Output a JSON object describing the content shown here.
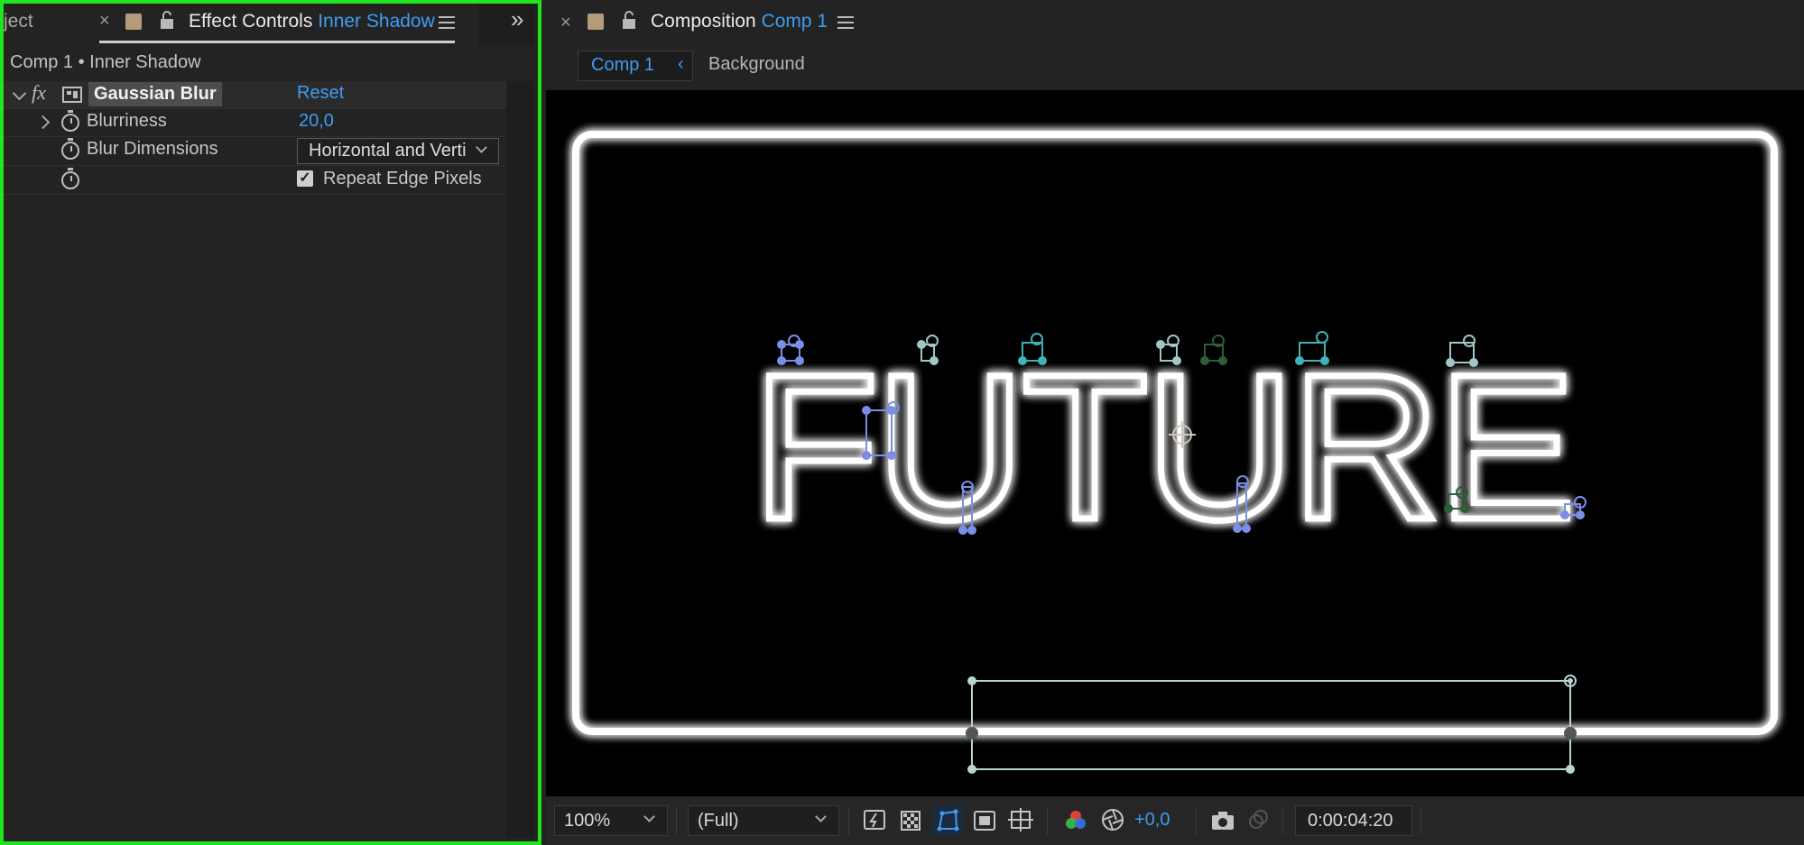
{
  "left_panel": {
    "tabs": {
      "truncated_tab_label": "ject",
      "active_prefix": "Effect Controls",
      "active_layer": "Inner Shadow"
    },
    "breadcrumb": "Comp 1 • Inner Shadow",
    "effect": {
      "fx_label": "fx",
      "name": "Gaussian Blur",
      "reset_label": "Reset"
    },
    "properties": [
      {
        "label": "Blurriness",
        "value": "20,0"
      },
      {
        "label": "Blur Dimensions",
        "value": "Horizontal and Verti"
      },
      {
        "label": "",
        "checkbox_label": "Repeat Edge Pixels",
        "checked": true
      }
    ],
    "collapse_label": "»"
  },
  "right_panel": {
    "tab": {
      "prefix": "Composition",
      "comp_name": "Comp 1"
    },
    "nav": {
      "active": "Comp 1",
      "next": "Background"
    },
    "viewer": {
      "text": "FUTURE"
    },
    "toolbar": {
      "zoom": "100%",
      "resolution": "(Full)",
      "exposure": "+0,0",
      "timecode": "0:00:04:20"
    }
  },
  "colors": {
    "accent_blue": "#3f9cf0",
    "highlight_green": "#1fe61f",
    "panel_bg": "#232323",
    "viewer_bg": "#000000",
    "neon": "#ffffff",
    "handle_blue": "#7a8ee6",
    "handle_teal": "#3fb3b8",
    "handle_green": "#2e5d3a"
  },
  "icons": [
    "close-icon",
    "lock-icon",
    "menu-icon",
    "chevron-icon",
    "stopwatch-icon",
    "checkbox-icon",
    "fast-preview-icon",
    "transparency-grid-icon",
    "mask-visibility-icon",
    "region-of-interest-icon",
    "guides-icon",
    "channel-icon",
    "exposure-reset-icon",
    "snapshot-icon",
    "show-snapshot-icon"
  ]
}
